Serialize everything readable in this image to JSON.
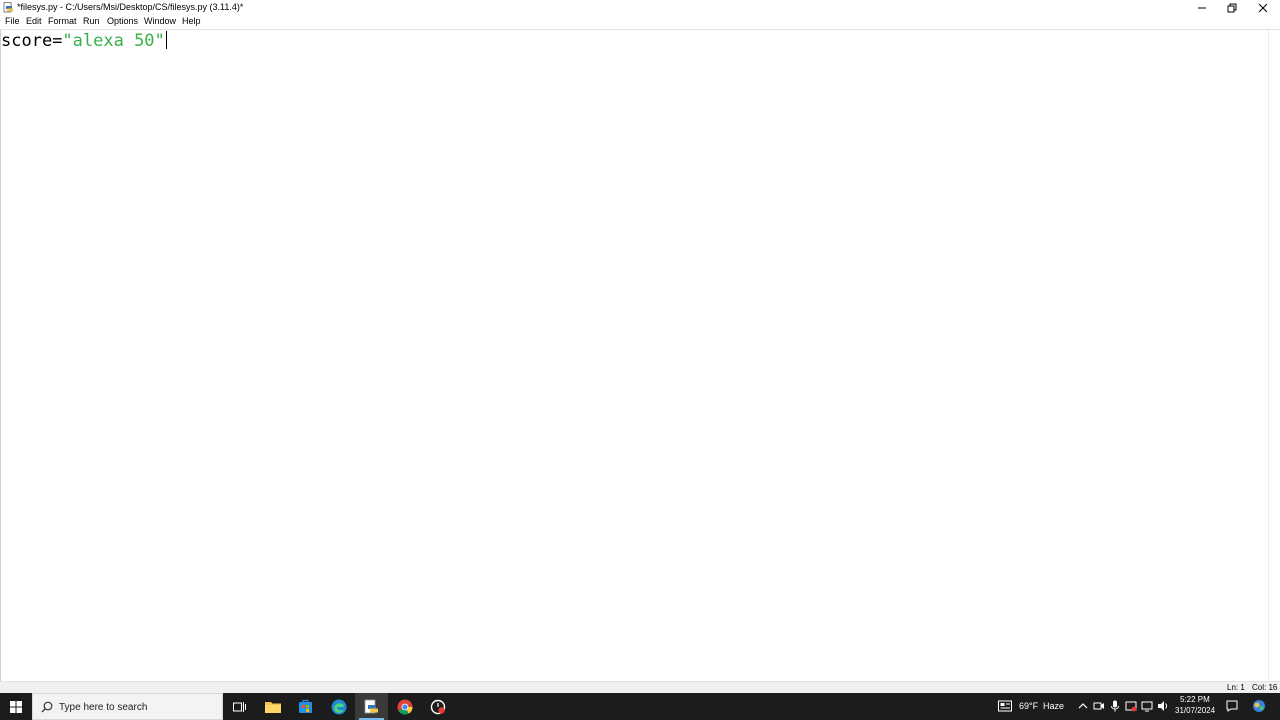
{
  "window": {
    "title": "*filesys.py - C:/Users/Msi/Desktop/CS/filesys.py (3.11.4)*",
    "icons": [
      "python-file-icon",
      "minimize-icon",
      "maximize-icon",
      "close-icon"
    ]
  },
  "menu": {
    "items": [
      {
        "label": "File"
      },
      {
        "label": "Edit"
      },
      {
        "label": "Format"
      },
      {
        "label": "Run"
      },
      {
        "label": "Options"
      },
      {
        "label": "Window"
      },
      {
        "label": "Help"
      }
    ]
  },
  "editor": {
    "tokens": [
      {
        "text": "score=",
        "kind": "default"
      },
      {
        "text": "\"alexa 50\"",
        "kind": "string"
      }
    ],
    "colors": {
      "default": "#000000",
      "string": "#39b14a"
    }
  },
  "status": {
    "line": "Ln: 1",
    "col": "Col: 16"
  },
  "taskbar": {
    "search_placeholder": "Type here to search",
    "apps": [
      "task-view-icon",
      "file-explorer-icon",
      "store-icon",
      "edge-icon",
      "idle-icon",
      "chrome-icon",
      "recorder-icon"
    ],
    "weather_temp": "69°F",
    "weather_desc": "Haze",
    "clock_time": "5:22 PM",
    "clock_date": "31/07/2024",
    "colors": {
      "taskbar_bg": "#1c1c1c",
      "accent": "#76b9ed"
    }
  }
}
